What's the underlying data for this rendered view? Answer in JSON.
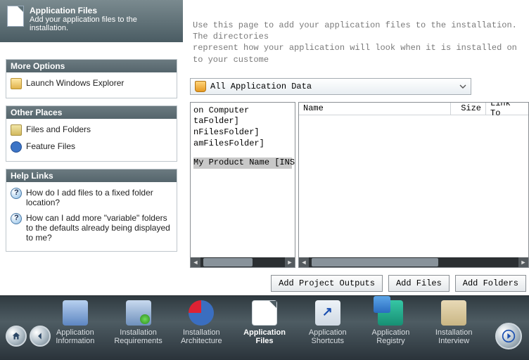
{
  "header": {
    "title": "Application Files",
    "subtitle": "Add your application files to the installation."
  },
  "intro": "Use this page to add your application files to the installation. The directories\nrepresent how your application will look when it is installed on to your custome",
  "combo": {
    "selected": "All Application Data"
  },
  "tree": {
    "lines": [
      "on Computer",
      "taFolder]",
      "nFilesFolder]",
      "amFilesFolder]"
    ],
    "selected": "My Product Name [INSTALLD"
  },
  "columns": {
    "name": "Name",
    "size": "Size",
    "link": "Link To"
  },
  "buttons": {
    "add_outputs": "Add Project Outputs",
    "add_files": "Add Files",
    "add_folders": "Add Folders"
  },
  "panels": {
    "more": {
      "title": "More Options",
      "items": [
        "Launch Windows Explorer"
      ]
    },
    "places": {
      "title": "Other Places",
      "items": [
        "Files and Folders",
        "Feature Files"
      ]
    },
    "help": {
      "title": "Help Links",
      "items": [
        "How do I add files to a fixed folder location?",
        "How can I add more \"variable\" folders to the defaults already being displayed to me?"
      ]
    }
  },
  "nav": [
    {
      "label1": "Application",
      "label2": "Information"
    },
    {
      "label1": "Installation",
      "label2": "Requirements"
    },
    {
      "label1": "Installation",
      "label2": "Architecture"
    },
    {
      "label1": "Application",
      "label2": "Files"
    },
    {
      "label1": "Application",
      "label2": "Shortcuts"
    },
    {
      "label1": "Application",
      "label2": "Registry"
    },
    {
      "label1": "Installation",
      "label2": "Interview"
    }
  ]
}
